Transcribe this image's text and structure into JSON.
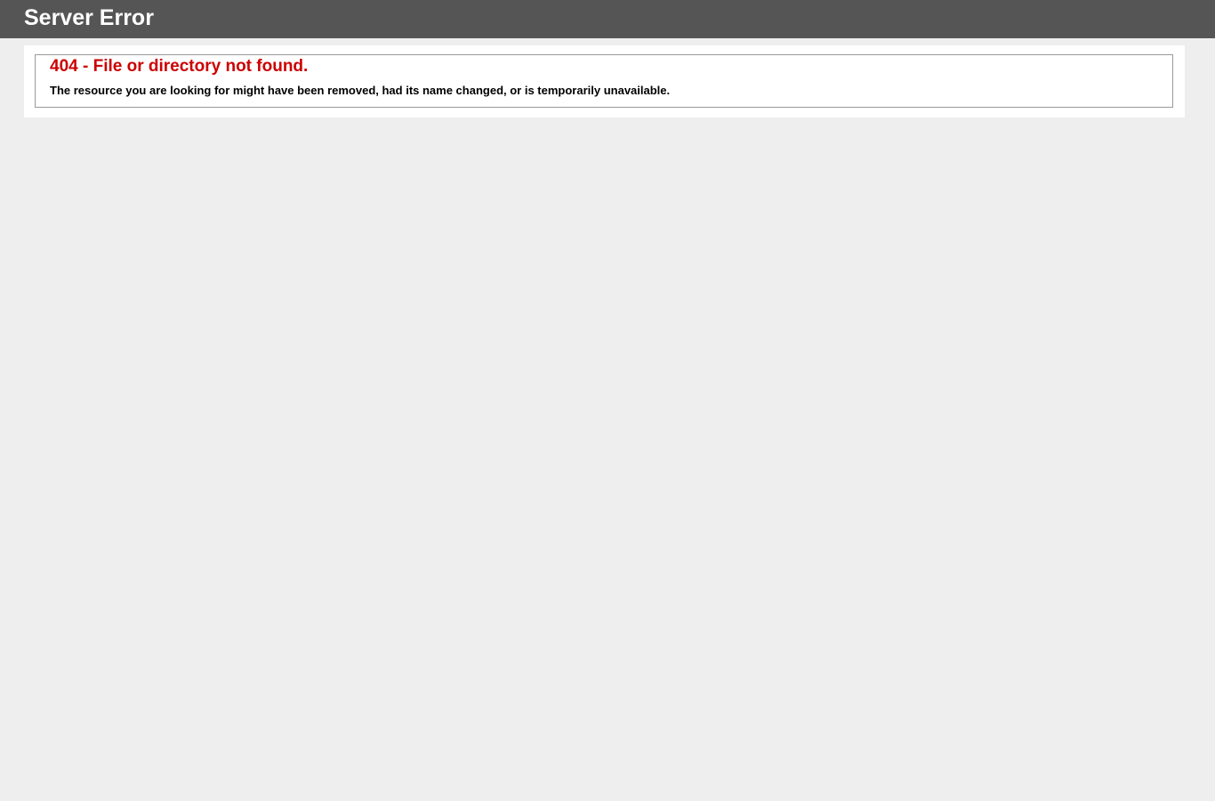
{
  "header": {
    "title": "Server Error"
  },
  "error": {
    "heading": "404 - File or directory not found.",
    "message": "The resource you are looking for might have been removed, had its name changed, or is temporarily unavailable."
  },
  "colors": {
    "header_bg": "#555555",
    "page_bg": "#eeeeee",
    "error_red": "#cc0000"
  }
}
